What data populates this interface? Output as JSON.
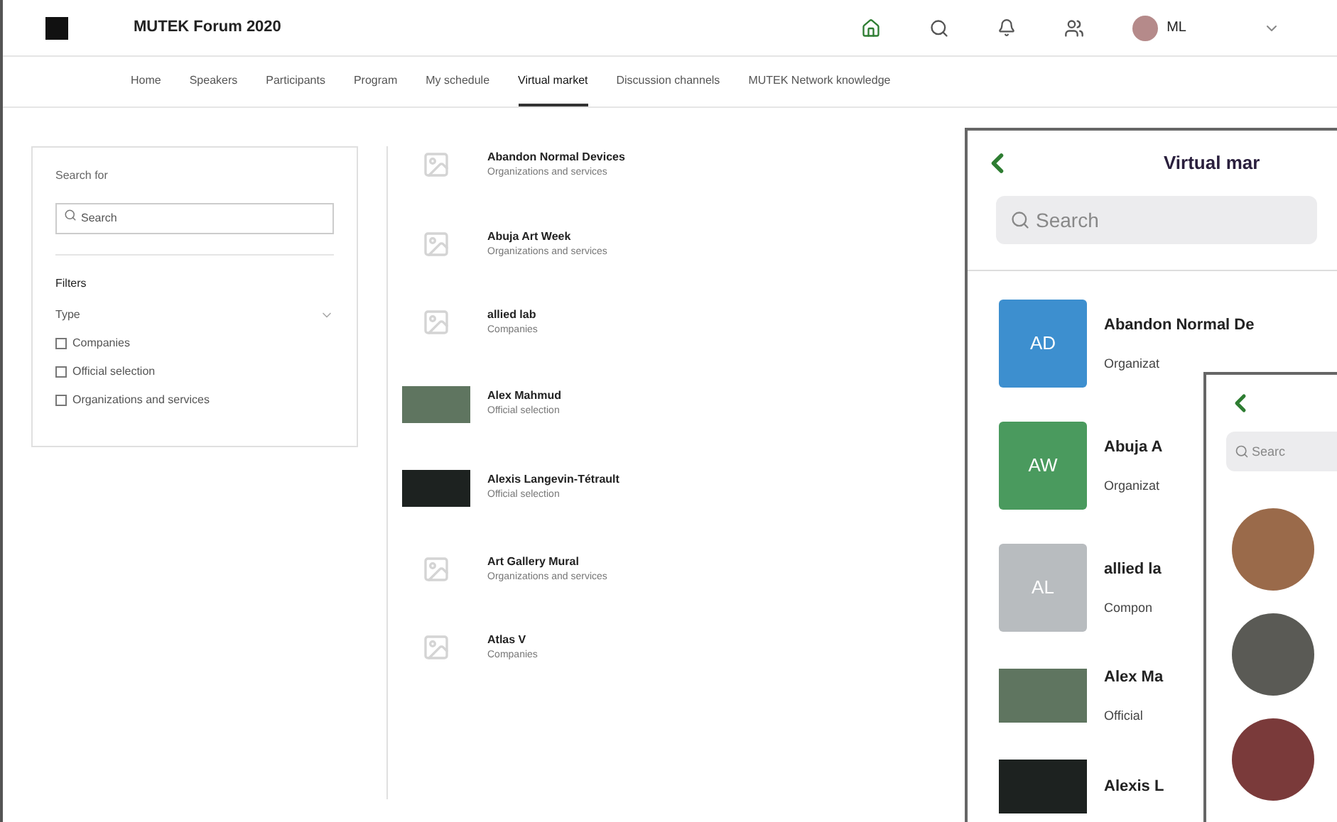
{
  "header": {
    "title": "MUTEK Forum 2020",
    "user_initials": "ML"
  },
  "nav": {
    "tabs": [
      {
        "label": "Home",
        "selected": false
      },
      {
        "label": "Speakers",
        "selected": false
      },
      {
        "label": "Participants",
        "selected": false
      },
      {
        "label": "Program",
        "selected": false
      },
      {
        "label": "My schedule",
        "selected": false
      },
      {
        "label": "Virtual market",
        "selected": true
      },
      {
        "label": "Discussion channels",
        "selected": false
      },
      {
        "label": "MUTEK Network knowledge",
        "selected": false
      }
    ]
  },
  "sidebar": {
    "search_label": "Search for",
    "search": {
      "placeholder": "Search"
    },
    "filters_title": "Filters",
    "type_label": "Type",
    "options": [
      {
        "label": "Companies",
        "checked": false
      },
      {
        "label": "Official selection",
        "checked": false
      },
      {
        "label": "Organizations and services",
        "checked": false
      }
    ]
  },
  "list": [
    {
      "name": "Abandon Normal Devices",
      "category": "Organizations and services",
      "kind": "placeholder"
    },
    {
      "name": "Abuja Art Week",
      "category": "Organizations and services",
      "kind": "placeholder"
    },
    {
      "name": "allied lab",
      "category": "Companies",
      "kind": "placeholder"
    },
    {
      "name": "Alex Mahmud",
      "category": "Official selection",
      "kind": "photo"
    },
    {
      "name": "Alexis Langevin-Tétrault",
      "category": "Official selection",
      "kind": "dark-photo"
    },
    {
      "name": "Art Gallery Mural",
      "category": "Organizations and services",
      "kind": "placeholder"
    },
    {
      "name": "Atlas V",
      "category": "Companies",
      "kind": "placeholder"
    }
  ],
  "mobile_screen": {
    "title": "Virtual mar",
    "search": {
      "placeholder": "Search"
    },
    "items": [
      {
        "initials": "AD",
        "name": "Abandon Normal De",
        "category": "Organizat",
        "color": "#3d8fcf",
        "kind": "initials"
      },
      {
        "initials": "AW",
        "name": "Abuja A",
        "category": "Organizat",
        "color": "#4a9a5e",
        "kind": "initials"
      },
      {
        "initials": "AL",
        "name": "allied la",
        "category": "Compon",
        "color": "#b8bcbf",
        "kind": "initials"
      },
      {
        "name": "Alex Ma",
        "category": "Official",
        "kind": "photo"
      },
      {
        "name": "Alexis L",
        "kind": "dark-photo"
      }
    ]
  },
  "mobile_screen_2": {
    "search": {
      "placeholder": "Searc"
    }
  }
}
